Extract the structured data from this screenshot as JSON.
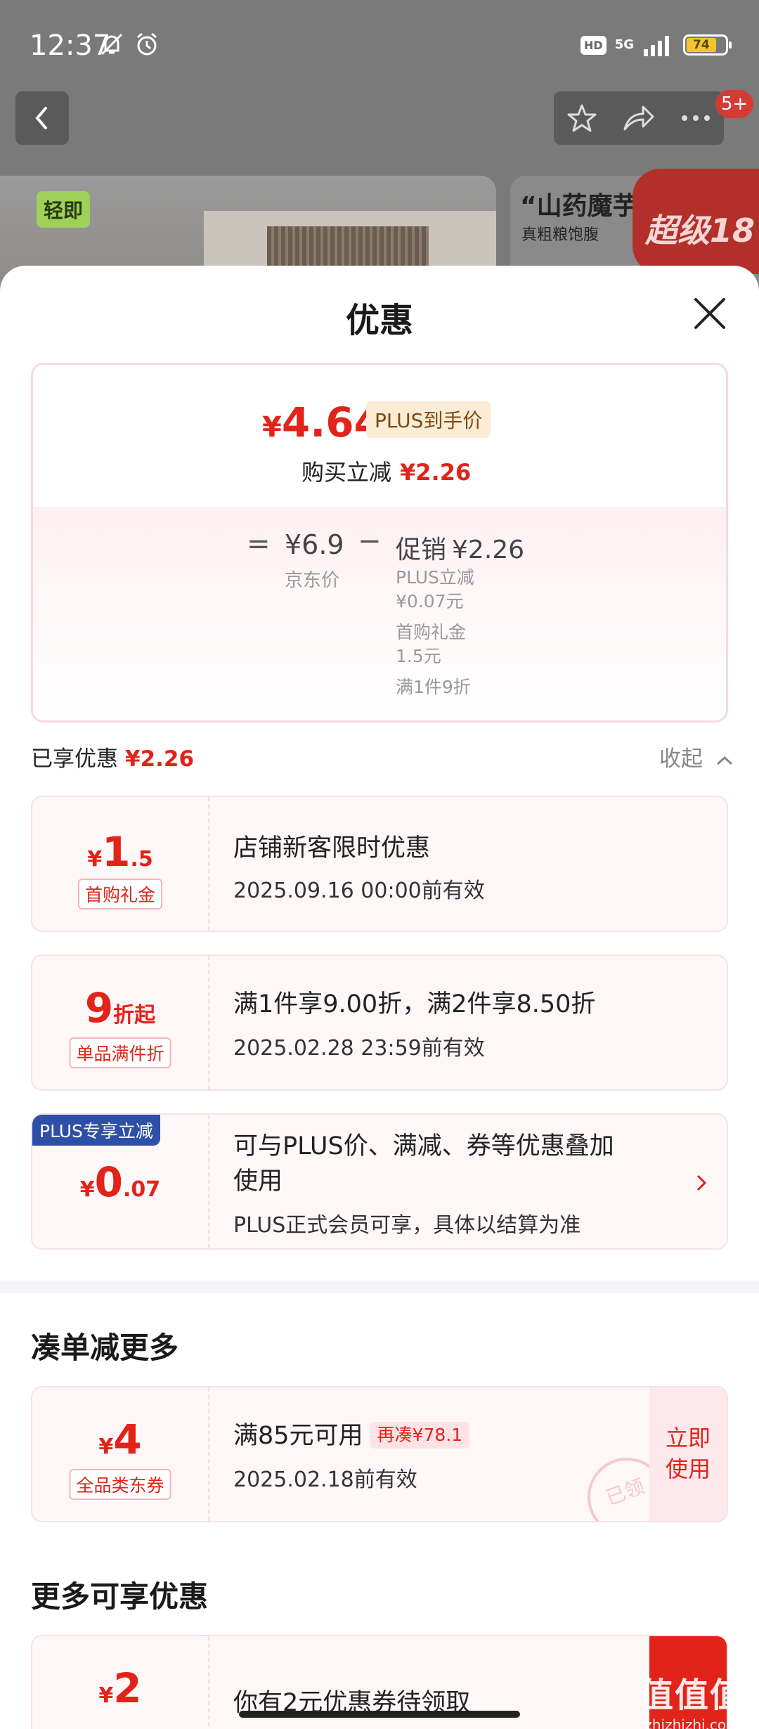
{
  "status_bar": {
    "time": "12:37",
    "hd": "HD",
    "network": "5G",
    "battery": "74"
  },
  "background": {
    "cart_badge": "5+",
    "product_left_tag": "轻即",
    "product_right_title": "“山药魔芋”",
    "product_right_sub": "真粗粮饱腹",
    "product_right_banner": "超级18"
  },
  "sheet": {
    "title": "优惠",
    "summary": {
      "yen": "¥",
      "final_price": "4.64",
      "plus_tag": "PLUS到手价",
      "buy_off_label": "购买立减",
      "buy_off_value": "¥2.26",
      "eq": "=",
      "jd_price": "¥6.9",
      "jd_label": "京东价",
      "minus": "−",
      "promo_label": "促销",
      "promo_value": "¥2.26",
      "details": [
        "PLUS立减",
        "¥0.07元",
        "首购礼金",
        "1.5元",
        "满1件9折"
      ]
    },
    "enjoyed": {
      "label": "已享优惠",
      "value": "¥2.26",
      "collapse": "收起"
    },
    "coupons": [
      {
        "prefix": "¥",
        "big": "1",
        "suffix": ".5",
        "tag": "首购礼金",
        "title": "店铺新客限时优惠",
        "sub": "2025.09.16 00:00前有效"
      },
      {
        "prefix": "",
        "big": "9",
        "suffix": "折起",
        "tag": "单品满件折",
        "title": "满1件享9.00折，满2件享8.50折",
        "sub": "2025.02.28 23:59前有效"
      },
      {
        "label": "PLUS专享立减",
        "prefix": "¥",
        "big": "0",
        "suffix": ".07",
        "title_line1": "可与PLUS价、满减、券等优惠叠加",
        "title_line2": "使用",
        "sub": "PLUS正式会员可享，具体以结算为准"
      }
    ],
    "more_section": {
      "title": "凑单减更多",
      "coupon": {
        "prefix": "¥",
        "big": "4",
        "tag": "全品类东券",
        "title": "满85元可用",
        "again_tag": "再凑¥78.1",
        "sub": "2025.02.18前有效",
        "stamp": "已领",
        "button_line1": "立即",
        "button_line2": "使用"
      }
    },
    "extra_section": {
      "title": "更多可享优惠",
      "coupon": {
        "prefix": "¥",
        "big": "2",
        "title": "你有2元优惠券待领取"
      }
    }
  },
  "watermark": {
    "big": "值值值",
    "small": "zhizhizhi.com"
  },
  "colors": {
    "accent_red": "#e2231a",
    "plus_blue": "#2e4fa8",
    "plus_gold_bg": "#fbecd5"
  }
}
